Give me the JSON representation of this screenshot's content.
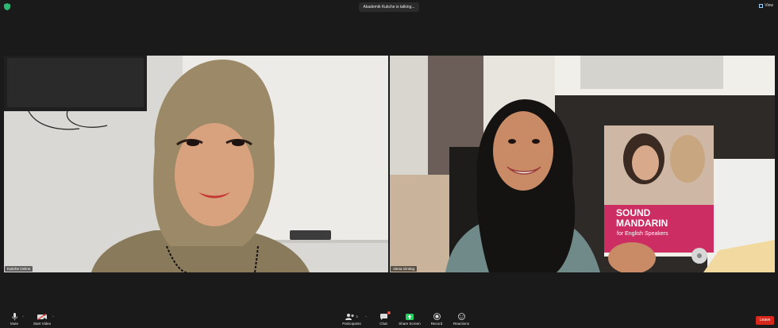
{
  "topbar": {
    "speaking_indicator": "Akademik Kukche is talking...",
    "view_label": "View",
    "shield_icon": "shield-icon",
    "shield_color": "#2bb673"
  },
  "participants": [
    {
      "name": "Kukche Online"
    },
    {
      "name": "Alena Ginting"
    }
  ],
  "book_cover": {
    "title_line1": "SOUND",
    "title_line2": "MANDARIN",
    "subtitle": "for English Speakers"
  },
  "toolbar": {
    "mute_label": "Mute",
    "start_video_label": "Start Video",
    "participants_label": "Participants",
    "participants_count": "3",
    "chat_label": "Chat",
    "chat_badge": "2",
    "share_screen_label": "Share Screen",
    "record_label": "Record",
    "reactions_label": "Reactions",
    "leave_label": "Leave",
    "share_color": "#23d160",
    "leave_color": "#d8281b"
  }
}
